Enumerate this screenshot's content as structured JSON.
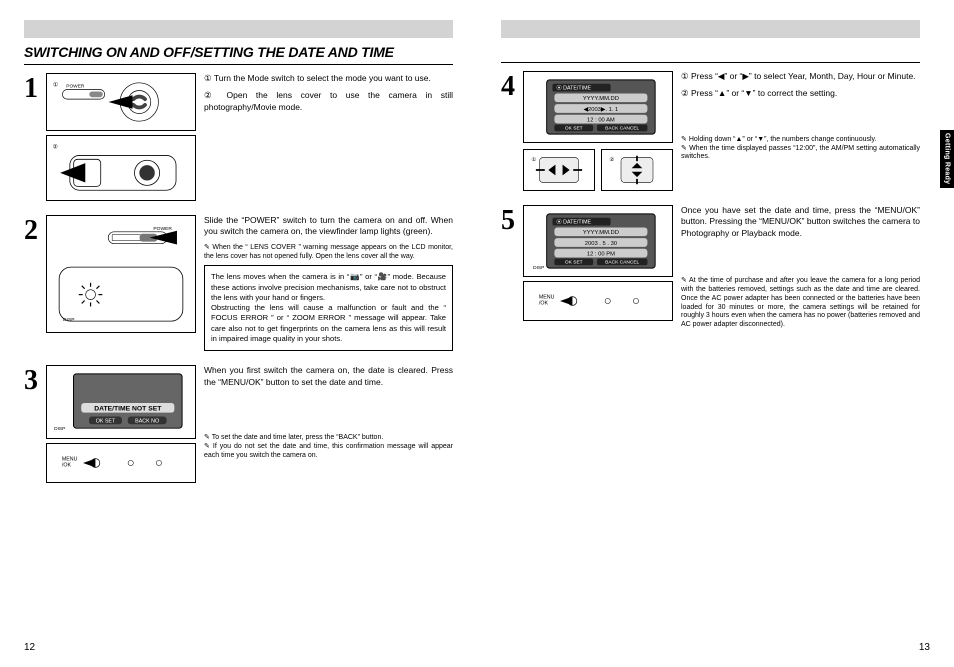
{
  "title": "SWITCHING ON AND OFF/SETTING THE DATE AND TIME",
  "side_tab": "Getting Ready",
  "page_numbers": {
    "left": "12",
    "right": "13"
  },
  "steps": {
    "1": {
      "lines": [
        "① Turn the Mode switch to select the mode you want to use.",
        "② Open the lens cover to use the camera in still photography/Movie mode."
      ]
    },
    "2": {
      "copy": "Slide the “POWER” switch to turn the camera on and off. When you switch the camera on, the viewfinder lamp lights (green).",
      "note": "When the “ LENS COVER ” warning message appears on the LCD monitor, the lens cover has not opened fully. Open the lens cover all the way.",
      "callout": "The lens moves when the camera is in “📷” or “🎥” mode. Because these actions involve precision mechanisms, take care not to obstruct the lens with your hand or fingers.\nObstructing the lens will cause a malfunction or fault and the “ FOCUS ERROR ” or “ ZOOM ERROR ” message will appear. Take care also not to get fingerprints on the camera lens as this will result in impaired image quality in your shots."
    },
    "3": {
      "copy": "When you first switch the camera on, the date is cleared. Press the “MENU/OK” button to set the date and time.",
      "notes": [
        "To set the date and time later, press the “BACK” button.",
        "If you do not set the date and time, this confirmation message will appear each time you switch the camera on."
      ]
    },
    "4": {
      "lines": [
        "① Press “◀” or “▶” to select Year, Month, Day, Hour or Minute.",
        "② Press “▲” or “▼” to correct the setting."
      ],
      "notes": [
        "Holding down “▲” or “▼”, the numbers change continuously.",
        "When the time displayed passes “12:00”, the AM/PM setting automatically switches."
      ]
    },
    "5": {
      "copy": "Once you have set the date and time, press the “MENU/OK” button. Pressing the “MENU/OK” button switches the camera to Photography or Playback mode.",
      "note": "At the time of purchase and after you leave the camera for a long period with the batteries removed, settings such as the date and time are cleared. Once the AC power adapter has been connected or the batteries have been loaded for 30 minutes or more, the camera settings will be retained for roughly 3 hours even when the camera has no power (batteries removed and AC power adapter disconnected)."
    }
  },
  "lcd": {
    "date_time_label": "DATE/TIME",
    "notset": "DATE/TIME NOT SET",
    "okset": "OK SET",
    "backno": "BACK NO",
    "backcancel": "BACK CANCEL",
    "row1": "YYYY.MM.DD",
    "row2a": "◀2003▶. 1. 1",
    "row2b": "2003 . 5 . 30",
    "row3a": "12 : 00   AM",
    "row3b": "12 : 00   PM"
  },
  "buttons": {
    "menu_ok": "MENU\n/OK",
    "disp": "DISP"
  },
  "camera_labels": {
    "power": "POWER"
  }
}
